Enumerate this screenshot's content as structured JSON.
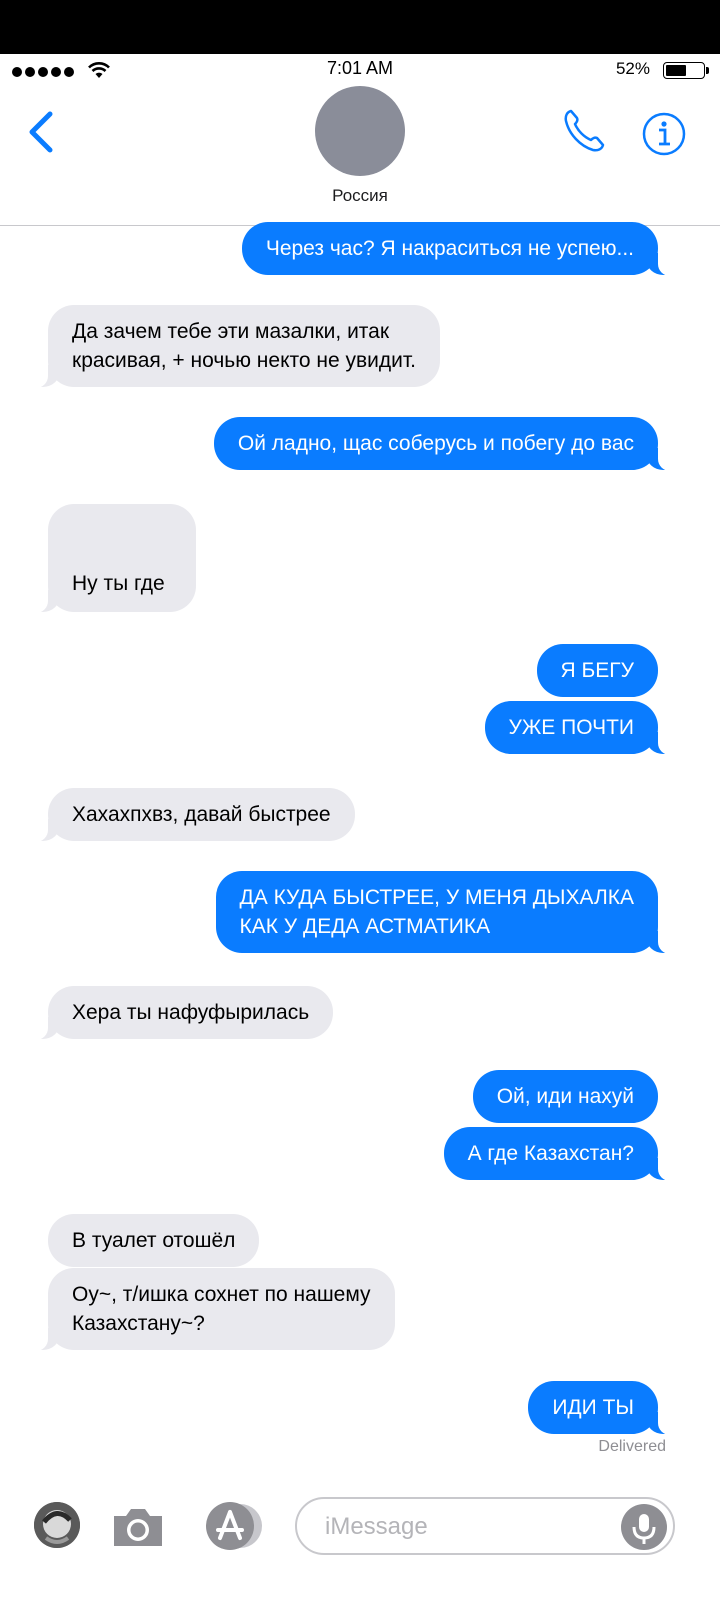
{
  "status_bar": {
    "time": "7:01 AM",
    "battery_percent": "52%",
    "battery_level": 0.52,
    "signal_bars": 5,
    "icons": [
      "signal-icon",
      "wifi-icon",
      "battery-icon"
    ]
  },
  "navbar": {
    "contact_name": "Россия",
    "icons": [
      "back-chevron-icon",
      "phone-icon",
      "info-icon"
    ],
    "accent_color": "#0a7cff"
  },
  "messages": [
    {
      "side": "out",
      "text": "Через час? Я накраситься не успею..."
    },
    {
      "side": "in",
      "text": "Да зачем тебе эти мазалки, итак\nкрасивая, + ночью некто не увидит."
    },
    {
      "side": "out",
      "text": "Ой ладно, щас соберусь и побегу до вас"
    },
    {
      "side": "in",
      "text": "Ну ты где"
    },
    {
      "side": "out",
      "text": "Я БЕГУ"
    },
    {
      "side": "out",
      "text": "УЖЕ ПОЧТИ"
    },
    {
      "side": "in",
      "text": "Хахахпхвз, давай быстрее"
    },
    {
      "side": "out",
      "text": "ДА КУДА БЫСТРЕЕ, У МЕНЯ ДЫХАЛКА\nКАК У ДЕДА АСТМАТИКА"
    },
    {
      "side": "in",
      "text": "Хера ты нафуфырилась"
    },
    {
      "side": "out",
      "text": "Ой, иди нахуй"
    },
    {
      "side": "out",
      "text": "А где Казахстан?"
    },
    {
      "side": "in",
      "text": "В туалет отошёл"
    },
    {
      "side": "in",
      "text": "Оу~, т/ишка сохнет по нашему\nКазахстану~?"
    },
    {
      "side": "out",
      "text": "ИДИ ТЫ"
    }
  ],
  "delivered_label": "Delivered",
  "input_bar": {
    "placeholder": "iMessage",
    "icons": [
      "memoji-avatar-icon",
      "camera-icon",
      "app-store-icon",
      "microphone-icon"
    ]
  },
  "colors": {
    "outgoing_bubble": "#0a7cff",
    "incoming_bubble": "#e9e9ee"
  }
}
